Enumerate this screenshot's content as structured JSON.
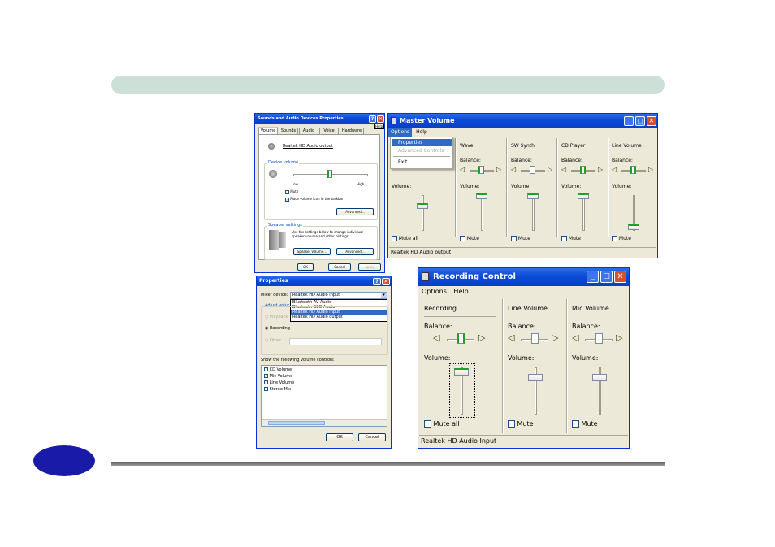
{
  "sound_props": {
    "title": "Sounds and Audio Devices Properties",
    "help_label": "Help",
    "tabs": [
      "Volume",
      "Sounds",
      "Audio",
      "Voice",
      "Hardware"
    ],
    "device_name": "Realtek HD Audio output",
    "device_volume_label": "Device volume",
    "low_label": "Low",
    "high_label": "High",
    "mute_label": "Mute",
    "place_icon_label": "Place volume icon in the taskbar",
    "advanced_label": "Advanced...",
    "speaker_settings_label": "Speaker settings",
    "speaker_text": "Use the settings below to change individual speaker volume and other settings.",
    "speaker_volume_label": "Speaker Volume...",
    "ok_label": "OK",
    "cancel_label": "Cancel",
    "apply_label": "Apply"
  },
  "master": {
    "title": "Master Volume",
    "menu": [
      "Options",
      "Help"
    ],
    "dropdown": [
      "Properties",
      "Advanced Controls",
      "Exit"
    ],
    "columns": [
      "Wave",
      "SW Synth",
      "CD Player",
      "Line Volume"
    ],
    "balance_label": "Balance:",
    "volume_label": "Volume:",
    "mute_all_label": "Mute all",
    "mute_label": "Mute",
    "status": "Realtek HD Audio output"
  },
  "props2": {
    "title": "Properties",
    "mixer_label": "Mixer device:",
    "mixer_value": "Realtek HD Audio input",
    "options": [
      "Bluetooth AV Audio",
      "Bluetooth SCO Audio",
      "Realtek HD Audio input",
      "Realtek HD Audio output"
    ],
    "adjust_label": "Adjust volume for",
    "playback_label": "Playback",
    "recording_label": "Recording",
    "other_label": "Other",
    "show_label": "Show the following volume controls:",
    "controls": [
      "CD Volume",
      "Mic Volume",
      "Line Volume",
      "Stereo Mix"
    ],
    "ok_label": "OK",
    "cancel_label": "Cancel"
  },
  "recording": {
    "title": "Recording Control",
    "menu": [
      "Options",
      "Help"
    ],
    "columns": [
      "Recording",
      "Line Volume",
      "Mic Volume"
    ],
    "balance_label": "Balance:",
    "volume_label": "Volume:",
    "mute_all_label": "Mute all",
    "mute_label": "Mute",
    "status": "Realtek HD Audio Input"
  }
}
